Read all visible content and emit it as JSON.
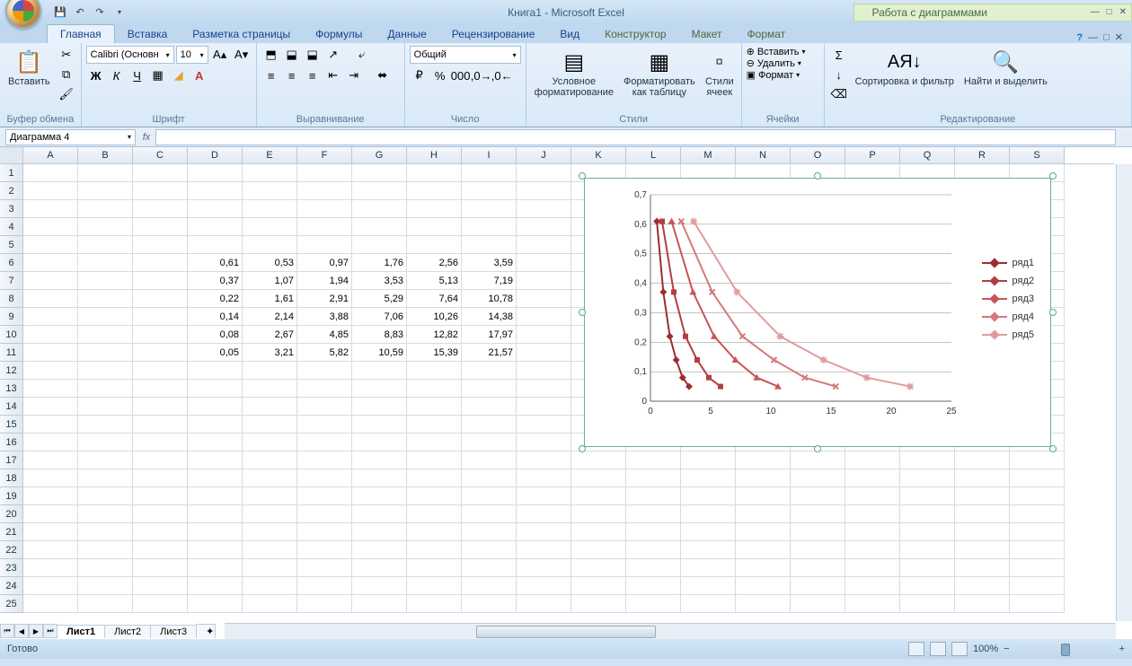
{
  "title": "Книга1 - Microsoft Excel",
  "chart_tools_title": "Работа с диаграммами",
  "tabs": {
    "home": "Главная",
    "insert": "Вставка",
    "layout": "Разметка страницы",
    "formulas": "Формулы",
    "data": "Данные",
    "review": "Рецензирование",
    "view": "Вид",
    "design": "Конструктор",
    "chartlayout": "Макет",
    "format": "Формат"
  },
  "ribbon": {
    "clipboard": {
      "title": "Буфер обмена",
      "paste": "Вставить"
    },
    "font": {
      "title": "Шрифт",
      "name": "Calibri (Основн",
      "size": "10"
    },
    "align": {
      "title": "Выравнивание"
    },
    "number": {
      "title": "Число",
      "format": "Общий"
    },
    "styles": {
      "title": "Стили",
      "cond": "Условное форматирование",
      "table": "Форматировать как таблицу",
      "cell": "Стили ячеек"
    },
    "cells": {
      "title": "Ячейки",
      "insert": "Вставить",
      "delete": "Удалить",
      "format": "Формат"
    },
    "editing": {
      "title": "Редактирование",
      "sort": "Сортировка и фильтр",
      "find": "Найти и выделить"
    }
  },
  "name_box": "Диаграмма 4",
  "columns": [
    "A",
    "B",
    "C",
    "D",
    "E",
    "F",
    "G",
    "H",
    "I",
    "J",
    "K",
    "L",
    "M",
    "N",
    "O",
    "P",
    "Q",
    "R",
    "S"
  ],
  "rows": [
    1,
    2,
    3,
    4,
    5,
    6,
    7,
    8,
    9,
    10,
    11,
    12,
    13,
    14,
    15,
    16,
    17,
    18,
    19,
    20,
    21,
    22,
    23,
    24,
    25
  ],
  "table": {
    "start_row": 6,
    "start_col": 3,
    "data": [
      [
        "0,61",
        "0,53",
        "0,97",
        "1,76",
        "2,56",
        "3,59"
      ],
      [
        "0,37",
        "1,07",
        "1,94",
        "3,53",
        "5,13",
        "7,19"
      ],
      [
        "0,22",
        "1,61",
        "2,91",
        "5,29",
        "7,64",
        "10,78"
      ],
      [
        "0,14",
        "2,14",
        "3,88",
        "7,06",
        "10,26",
        "14,38"
      ],
      [
        "0,08",
        "2,67",
        "4,85",
        "8,83",
        "12,82",
        "17,97"
      ],
      [
        "0,05",
        "3,21",
        "5,82",
        "10,59",
        "15,39",
        "21,57"
      ]
    ]
  },
  "sheets": [
    "Лист1",
    "Лист2",
    "Лист3"
  ],
  "status": "Готово",
  "zoom": "100%",
  "chart_data": {
    "type": "line",
    "xlim": [
      0,
      25
    ],
    "ylim": [
      0,
      0.7
    ],
    "xticks": [
      0,
      5,
      10,
      15,
      20,
      25
    ],
    "yticks": [
      0,
      0.1,
      0.2,
      0.3,
      0.4,
      0.5,
      0.6,
      0.7
    ],
    "series": [
      {
        "name": "ряд1",
        "color": "#9b2d30",
        "marker": "diamond",
        "points": [
          [
            0.53,
            0.61
          ],
          [
            1.07,
            0.37
          ],
          [
            1.61,
            0.22
          ],
          [
            2.14,
            0.14
          ],
          [
            2.67,
            0.08
          ],
          [
            3.21,
            0.05
          ]
        ]
      },
      {
        "name": "ряд2",
        "color": "#b33e42",
        "marker": "square",
        "points": [
          [
            0.97,
            0.61
          ],
          [
            1.94,
            0.37
          ],
          [
            2.91,
            0.22
          ],
          [
            3.88,
            0.14
          ],
          [
            4.85,
            0.08
          ],
          [
            5.82,
            0.05
          ]
        ]
      },
      {
        "name": "ряд3",
        "color": "#c75558",
        "marker": "triangle",
        "points": [
          [
            1.76,
            0.61
          ],
          [
            3.53,
            0.37
          ],
          [
            5.29,
            0.22
          ],
          [
            7.06,
            0.14
          ],
          [
            8.83,
            0.08
          ],
          [
            10.59,
            0.05
          ]
        ]
      },
      {
        "name": "ряд4",
        "color": "#d6787b",
        "marker": "x",
        "points": [
          [
            2.56,
            0.61
          ],
          [
            5.13,
            0.37
          ],
          [
            7.64,
            0.22
          ],
          [
            10.26,
            0.14
          ],
          [
            12.82,
            0.08
          ],
          [
            15.39,
            0.05
          ]
        ]
      },
      {
        "name": "ряд5",
        "color": "#e29b9d",
        "marker": "star",
        "points": [
          [
            3.59,
            0.61
          ],
          [
            7.19,
            0.37
          ],
          [
            10.78,
            0.22
          ],
          [
            14.38,
            0.14
          ],
          [
            17.97,
            0.08
          ],
          [
            21.57,
            0.05
          ]
        ]
      }
    ]
  }
}
